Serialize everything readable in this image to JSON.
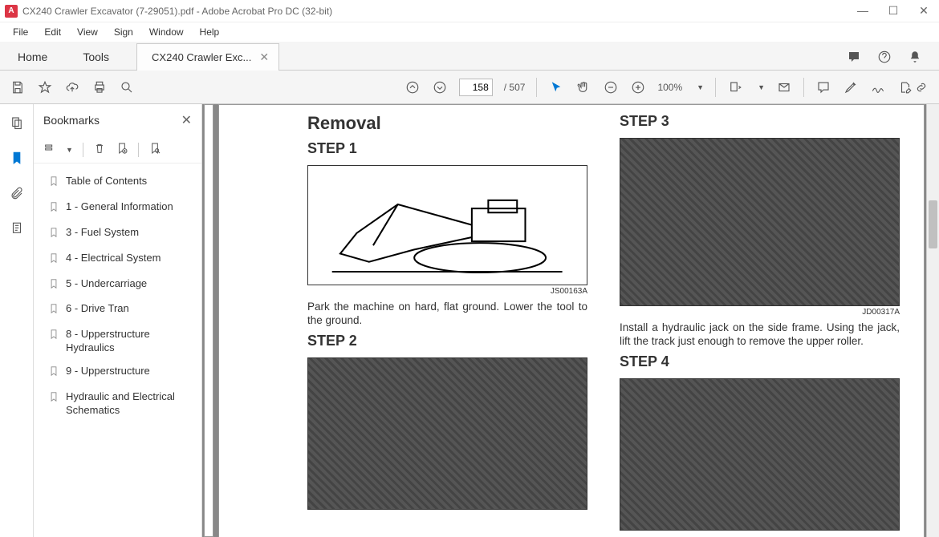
{
  "window": {
    "title": "CX240 Crawler Excavator (7-29051).pdf - Adobe Acrobat Pro DC (32-bit)"
  },
  "menu": [
    "File",
    "Edit",
    "View",
    "Sign",
    "Window",
    "Help"
  ],
  "tabs": {
    "home": "Home",
    "tools": "Tools",
    "document": "CX240 Crawler Exc..."
  },
  "toolbar": {
    "page_current": "158",
    "page_total": "/  507",
    "zoom": "100%"
  },
  "bookmarks": {
    "title": "Bookmarks",
    "items": [
      "Table of Contents",
      "1 - General Information",
      "3 - Fuel System",
      "4 - Electrical System",
      "5 - Undercarriage",
      "6 - Drive Tran",
      "8 - Upperstructure Hydraulics",
      "9 - Upperstructure",
      "Hydraulic and Electrical Schematics"
    ]
  },
  "doc": {
    "title": "Removal",
    "step1": "STEP 1",
    "step1_code": "JS00163A",
    "step1_text": "Park the machine on hard, flat ground. Lower the tool to the ground.",
    "step2": "STEP 2",
    "step3": "STEP 3",
    "step3_code": "JD00317A",
    "step3_text": "Install a hydraulic jack on the side frame. Using the jack, lift the track just enough to remove the upper roller.",
    "step4": "STEP 4"
  }
}
